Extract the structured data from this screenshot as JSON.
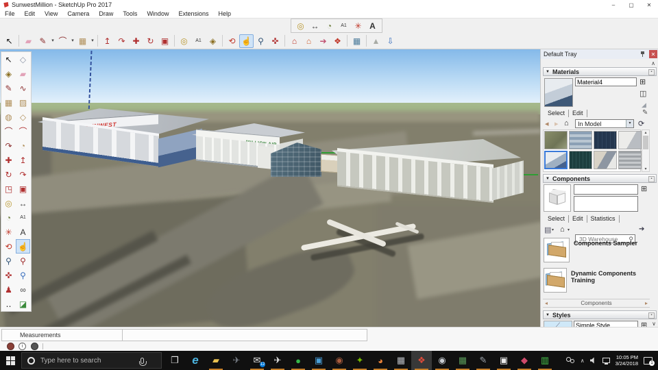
{
  "theme": {
    "accent_underline": "#c77f28",
    "sketchup_red": "#cf3732",
    "pan_highlight": "#cfe3f7"
  },
  "window": {
    "title": "SunwestMillion - SketchUp Pro 2017",
    "minimize": "–",
    "maximize": "▢",
    "close": "✕"
  },
  "menu": {
    "items": [
      "File",
      "Edit",
      "View",
      "Camera",
      "Draw",
      "Tools",
      "Window",
      "Extensions",
      "Help"
    ]
  },
  "construction_toolbar": {
    "icons": [
      {
        "name": "tape-measure-icon",
        "glyph": "◎",
        "color": "#b8962e"
      },
      {
        "name": "dimension-icon",
        "glyph": "↔",
        "color": "#444444"
      },
      {
        "name": "protractor-icon",
        "glyph": "◔",
        "color": "#6a7a3a"
      },
      {
        "name": "text-icon",
        "glyph": "A1",
        "color": "#333333",
        "cls": "boxed"
      },
      {
        "name": "axes-icon",
        "glyph": "✳",
        "color": "#c0392b"
      },
      {
        "name": "3d-text-icon",
        "glyph": "A",
        "color": "#333333",
        "cls": "bold"
      }
    ]
  },
  "main_toolbar": {
    "items": [
      {
        "name": "tool-select",
        "glyph": "↖",
        "color": "#111111"
      },
      {
        "name": "toolbar-separator",
        "cls": "tsep"
      },
      {
        "name": "tool-eraser",
        "glyph": "▰",
        "color": "#e2a2b8"
      },
      {
        "name": "tool-line",
        "glyph": "✎",
        "color": "#8d2f2f"
      },
      {
        "name": "line-dropdown-arrow",
        "glyph": "▾",
        "cls": "tdrop"
      },
      {
        "name": "tool-arc",
        "glyph": "⌒",
        "color": "#8d2f2f"
      },
      {
        "name": "arc-dropdown-arrow",
        "glyph": "▾",
        "cls": "tdrop"
      },
      {
        "name": "tool-rectangle",
        "glyph": "▦",
        "color": "#b08f5a"
      },
      {
        "name": "rectangle-dropdown-arrow",
        "glyph": "▾",
        "cls": "tdrop"
      },
      {
        "name": "toolbar-separator",
        "cls": "tsep"
      },
      {
        "name": "tool-push-pull",
        "glyph": "↥",
        "color": "#b03030"
      },
      {
        "name": "tool-follow-me",
        "glyph": "↷",
        "color": "#b03030"
      },
      {
        "name": "tool-move",
        "glyph": "✚",
        "color": "#b03030"
      },
      {
        "name": "tool-rotate",
        "glyph": "↻",
        "color": "#b03030"
      },
      {
        "name": "tool-offset",
        "glyph": "▣",
        "color": "#b03030"
      },
      {
        "name": "toolbar-separator",
        "cls": "tsep"
      },
      {
        "name": "tool-tape-measure",
        "glyph": "◎",
        "color": "#b8962e"
      },
      {
        "name": "tool-text",
        "glyph": "A1",
        "color": "#333333",
        "cls": "boxed"
      },
      {
        "name": "tool-paint-bucket",
        "glyph": "◈",
        "color": "#8a6d1f"
      },
      {
        "name": "toolbar-separator",
        "cls": "tsep"
      },
      {
        "name": "tool-orbit",
        "glyph": "⟲",
        "color": "#c0392b"
      },
      {
        "name": "tool-pan",
        "glyph": "☝",
        "color": "#b98a55",
        "cls": "active"
      },
      {
        "name": "tool-zoom",
        "glyph": "⚲",
        "color": "#335577"
      },
      {
        "name": "tool-zoom-extents",
        "glyph": "✜",
        "color": "#b03030"
      },
      {
        "name": "toolbar-separator",
        "cls": "tsep"
      },
      {
        "name": "button-3d-warehouse",
        "glyph": "⌂",
        "color": "#c0392b"
      },
      {
        "name": "button-share-model",
        "glyph": "⌂",
        "color": "#d06030"
      },
      {
        "name": "button-share-component",
        "glyph": "➔",
        "color": "#c05070"
      },
      {
        "name": "button-extension-warehouse",
        "glyph": "❖",
        "color": "#c0392b"
      },
      {
        "name": "toolbar-separator",
        "cls": "tsep"
      },
      {
        "name": "button-add-location",
        "glyph": "▦",
        "color": "#4a7a9a"
      },
      {
        "name": "toolbar-separator",
        "cls": "tsep"
      },
      {
        "name": "button-toggle-terrain",
        "glyph": "▲",
        "color": "#a9aca6"
      },
      {
        "name": "button-photo-textures",
        "glyph": "⇩",
        "color": "#3a6fbe"
      }
    ]
  },
  "large_tool_set": {
    "tools": [
      {
        "name": "tool-select",
        "glyph": "↖",
        "color": "#111111"
      },
      {
        "name": "tool-make-component",
        "glyph": "◇",
        "color": "#8a93a5"
      },
      {
        "name": "tool-paint-bucket",
        "glyph": "◈",
        "color": "#8a6d1f"
      },
      {
        "name": "tool-eraser",
        "glyph": "▰",
        "color": "#e2a2b8"
      },
      {
        "name": "tool-line",
        "glyph": "✎",
        "color": "#8d2f2f"
      },
      {
        "name": "tool-freehand",
        "glyph": "∿",
        "color": "#8d2f2f"
      },
      {
        "name": "tool-rectangle",
        "glyph": "▦",
        "color": "#b08f5a"
      },
      {
        "name": "tool-rotated-rectangle",
        "glyph": "▨",
        "color": "#b08f5a"
      },
      {
        "name": "tool-circle",
        "glyph": "◍",
        "color": "#b08f5a"
      },
      {
        "name": "tool-polygon",
        "glyph": "◇",
        "color": "#b08f5a"
      },
      {
        "name": "tool-arc",
        "glyph": "⌒",
        "color": "#8d2f2f"
      },
      {
        "name": "tool-2-point-arc",
        "glyph": "⌒",
        "color": "#b03030"
      },
      {
        "name": "tool-3-point-arc",
        "glyph": "↷",
        "color": "#8d2f2f"
      },
      {
        "name": "tool-pie",
        "glyph": "◔",
        "color": "#b08f5a"
      },
      {
        "name": "tool-move",
        "glyph": "✚",
        "color": "#b03030"
      },
      {
        "name": "tool-push-pull",
        "glyph": "↥",
        "color": "#b03030"
      },
      {
        "name": "tool-rotate",
        "glyph": "↻",
        "color": "#b03030"
      },
      {
        "name": "tool-follow-me",
        "glyph": "↷",
        "color": "#b03030"
      },
      {
        "name": "tool-scale",
        "glyph": "◳",
        "color": "#b03030"
      },
      {
        "name": "tool-offset",
        "glyph": "▣",
        "color": "#b03030"
      },
      {
        "name": "tool-tape-measure",
        "glyph": "◎",
        "color": "#b8962e"
      },
      {
        "name": "tool-dimension",
        "glyph": "↔",
        "color": "#444444"
      },
      {
        "name": "tool-protractor",
        "glyph": "◔",
        "color": "#6a7a3a"
      },
      {
        "name": "tool-text",
        "glyph": "A1",
        "color": "#333333",
        "cls": "boxed"
      },
      {
        "name": "tool-axes",
        "glyph": "✳",
        "color": "#c0392b"
      },
      {
        "name": "tool-3d-text",
        "glyph": "A",
        "color": "#333333"
      },
      {
        "name": "tool-orbit",
        "glyph": "⟲",
        "color": "#c0392b"
      },
      {
        "name": "tool-pan",
        "glyph": "☝",
        "color": "#b98a55",
        "cls": "active"
      },
      {
        "name": "tool-zoom",
        "glyph": "⚲",
        "color": "#335577"
      },
      {
        "name": "tool-zoom-window",
        "glyph": "⚲",
        "color": "#a03030"
      },
      {
        "name": "tool-zoom-extents",
        "glyph": "✜",
        "color": "#b03030"
      },
      {
        "name": "tool-zoom-previous",
        "glyph": "⚲",
        "color": "#3a6fbe"
      },
      {
        "name": "tool-position-camera",
        "glyph": "♟",
        "color": "#b03030"
      },
      {
        "name": "tool-look-around",
        "glyph": "∞",
        "color": "#444444"
      },
      {
        "name": "tool-walk",
        "glyph": "‥",
        "color": "#222222"
      },
      {
        "name": "tool-section-plane",
        "glyph": "◪",
        "color": "#3a8a3a"
      }
    ]
  },
  "viewport": {
    "sunwest_sign": "SUNWEST",
    "sunwest_color": "#cf3732",
    "million_air_sign": "MILLION AIR",
    "million_air_color": "#2e7d32"
  },
  "tray": {
    "title": "Default Tray",
    "close": "✕",
    "scroll_up": "∧",
    "scroll_down": "∨",
    "materials": {
      "header": "Materials",
      "collapse": "▼",
      "menu_btn": "▪",
      "name_value": "Material4",
      "create_icon": "⊞",
      "pane_icon": "◫",
      "corner_icon": "◢",
      "sample_icon": "✎",
      "tabs": [
        "Select",
        "Edit"
      ],
      "nav_back": "◂",
      "nav_forward": "▸",
      "home": "⌂",
      "dropdown_value": "In Model",
      "dropdown_arrow": "▾",
      "details_icon": "⟳",
      "thumb_scroll_up": "▴",
      "thumb_scroll_down": "▾",
      "thumbnails": [
        {
          "name": "material-thumb-aerial",
          "bg": "linear-gradient(135deg,#8a8f6a,#6f7456 60%,#9aa07e)"
        },
        {
          "name": "material-thumb-blue-stripes",
          "bg": "repeating-linear-gradient(180deg,#8ba0b5 0 4px,#b9c6d2 4px 8px)"
        },
        {
          "name": "material-thumb-navy-grid",
          "bg": "repeating-linear-gradient(90deg,#24364e 0 5px,#31465f 5px 6px)"
        },
        {
          "name": "material-thumb-white-building",
          "bg": "linear-gradient(120deg,#ececea 55%,#b9bdc2 55%)"
        },
        {
          "name": "material-thumb-hangar-selected",
          "bg": "linear-gradient(150deg,#e8ecf0 45%,#9fb0c2 45% 75%,#46628e 75%)",
          "cls": "sel"
        },
        {
          "name": "material-thumb-teal-grid",
          "bg": "repeating-linear-gradient(90deg,#1d3f3f 0 4px,#2c5252 4px 5px)"
        },
        {
          "name": "material-thumb-photo",
          "bg": "linear-gradient(120deg,#d8d2c6 40%,#8d96a2 40% 70%,#e8e8e6 70%)"
        },
        {
          "name": "material-thumb-gray-stripes",
          "bg": "repeating-linear-gradient(180deg,#9fa3a7 0 3px,#c6c9cc 3px 6px)"
        }
      ]
    },
    "components": {
      "header": "Components",
      "collapse": "▼",
      "menu_btn": "▪",
      "pane_icon": "⊞",
      "tabs": [
        "Select",
        "Edit",
        "Statistics"
      ],
      "view_icon": "▤",
      "view_arrow": "▾",
      "home": "⌂",
      "home_arrow": "▾",
      "search_placeholder": "3D Warehouse",
      "magnifier": "⚲",
      "details_icon": "➔",
      "items": [
        {
          "name": "component-folder-components-sampler",
          "label": "Components Sampler"
        },
        {
          "name": "component-folder-dynamic-components-training",
          "label": "Dynamic Components Training"
        }
      ],
      "nav_back": "◂",
      "nav_forward": "▸",
      "nav_label": "Components"
    },
    "styles": {
      "header": "Styles",
      "collapse": "▼",
      "menu_btn": "▪",
      "name_value": "Simple Style",
      "pane_icon": "⊞",
      "thumb_glyph": "⟋"
    }
  },
  "status_bar": {
    "measurements_label": "Measurements"
  },
  "taskbar": {
    "search_placeholder": "Type here to search",
    "apps": [
      {
        "name": "taskbar-task-view",
        "glyph": "❐",
        "color": "#e8e8e8"
      },
      {
        "name": "taskbar-edge",
        "glyph": "e",
        "color": "#4cb4e0",
        "cls": "edge"
      },
      {
        "name": "taskbar-file-explorer",
        "glyph": "▰",
        "color": "#e8c050",
        "cls": "run"
      },
      {
        "name": "taskbar-airplane-gray",
        "glyph": "✈",
        "color": "#7a8088"
      },
      {
        "name": "taskbar-mail",
        "glyph": "✉",
        "color": "#e6e6e6",
        "cls": "run",
        "badge": "12"
      },
      {
        "name": "taskbar-airplane-white",
        "glyph": "✈",
        "color": "#ececec",
        "cls": "run"
      },
      {
        "name": "taskbar-green-app",
        "glyph": "●",
        "color": "#35b84a",
        "cls": "run"
      },
      {
        "name": "taskbar-blue-window-app",
        "glyph": "▣",
        "color": "#4a9fd8",
        "cls": "run"
      },
      {
        "name": "taskbar-browser-dark",
        "glyph": "◉",
        "color": "#a85c3e",
        "cls": "run"
      },
      {
        "name": "taskbar-nvidia",
        "glyph": "✦",
        "color": "#76b900",
        "cls": "run"
      },
      {
        "name": "taskbar-firefox",
        "glyph": "◕",
        "color": "#e8823a",
        "cls": "run"
      },
      {
        "name": "taskbar-gray-app",
        "glyph": "▦",
        "color": "#b9bcc2",
        "cls": "run"
      },
      {
        "name": "taskbar-sketchup",
        "glyph": "❖",
        "color": "#e04b3a",
        "cls": "run active"
      },
      {
        "name": "taskbar-google-earth",
        "glyph": "◉",
        "color": "#c8cdd3",
        "cls": "run"
      },
      {
        "name": "taskbar-map-app",
        "glyph": "▦",
        "color": "#5a9a5a",
        "cls": "run"
      },
      {
        "name": "taskbar-dark-tool",
        "glyph": "✎",
        "color": "#9aa0a8",
        "cls": "run"
      },
      {
        "name": "taskbar-photos",
        "glyph": "▣",
        "color": "#ececec",
        "cls": "run"
      },
      {
        "name": "taskbar-paint-app",
        "glyph": "◆",
        "color": "#d04a6a",
        "cls": "run"
      },
      {
        "name": "taskbar-green-monitor",
        "glyph": "▥",
        "color": "#46c24a",
        "cls": "run"
      }
    ],
    "clock": {
      "time": "10:05 PM",
      "date": "3/24/2018"
    },
    "notification_badge": "1"
  }
}
